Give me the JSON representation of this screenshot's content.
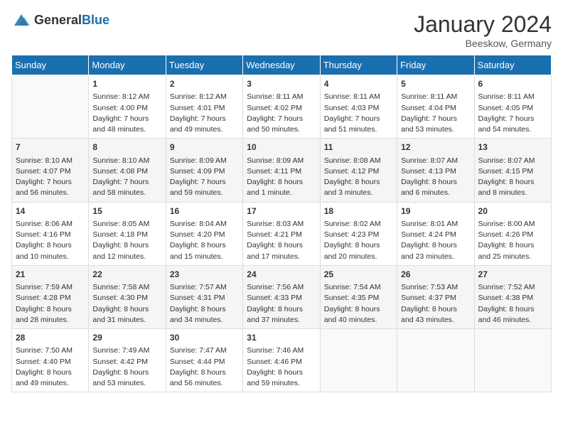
{
  "header": {
    "logo_general": "General",
    "logo_blue": "Blue",
    "month_year": "January 2024",
    "location": "Beeskow, Germany"
  },
  "days_of_week": [
    "Sunday",
    "Monday",
    "Tuesday",
    "Wednesday",
    "Thursday",
    "Friday",
    "Saturday"
  ],
  "weeks": [
    [
      {
        "day": "",
        "info": ""
      },
      {
        "day": "1",
        "info": "Sunrise: 8:12 AM\nSunset: 4:00 PM\nDaylight: 7 hours\nand 48 minutes."
      },
      {
        "day": "2",
        "info": "Sunrise: 8:12 AM\nSunset: 4:01 PM\nDaylight: 7 hours\nand 49 minutes."
      },
      {
        "day": "3",
        "info": "Sunrise: 8:11 AM\nSunset: 4:02 PM\nDaylight: 7 hours\nand 50 minutes."
      },
      {
        "day": "4",
        "info": "Sunrise: 8:11 AM\nSunset: 4:03 PM\nDaylight: 7 hours\nand 51 minutes."
      },
      {
        "day": "5",
        "info": "Sunrise: 8:11 AM\nSunset: 4:04 PM\nDaylight: 7 hours\nand 53 minutes."
      },
      {
        "day": "6",
        "info": "Sunrise: 8:11 AM\nSunset: 4:05 PM\nDaylight: 7 hours\nand 54 minutes."
      }
    ],
    [
      {
        "day": "7",
        "info": "Sunrise: 8:10 AM\nSunset: 4:07 PM\nDaylight: 7 hours\nand 56 minutes."
      },
      {
        "day": "8",
        "info": "Sunrise: 8:10 AM\nSunset: 4:08 PM\nDaylight: 7 hours\nand 58 minutes."
      },
      {
        "day": "9",
        "info": "Sunrise: 8:09 AM\nSunset: 4:09 PM\nDaylight: 7 hours\nand 59 minutes."
      },
      {
        "day": "10",
        "info": "Sunrise: 8:09 AM\nSunset: 4:11 PM\nDaylight: 8 hours\nand 1 minute."
      },
      {
        "day": "11",
        "info": "Sunrise: 8:08 AM\nSunset: 4:12 PM\nDaylight: 8 hours\nand 3 minutes."
      },
      {
        "day": "12",
        "info": "Sunrise: 8:07 AM\nSunset: 4:13 PM\nDaylight: 8 hours\nand 6 minutes."
      },
      {
        "day": "13",
        "info": "Sunrise: 8:07 AM\nSunset: 4:15 PM\nDaylight: 8 hours\nand 8 minutes."
      }
    ],
    [
      {
        "day": "14",
        "info": "Sunrise: 8:06 AM\nSunset: 4:16 PM\nDaylight: 8 hours\nand 10 minutes."
      },
      {
        "day": "15",
        "info": "Sunrise: 8:05 AM\nSunset: 4:18 PM\nDaylight: 8 hours\nand 12 minutes."
      },
      {
        "day": "16",
        "info": "Sunrise: 8:04 AM\nSunset: 4:20 PM\nDaylight: 8 hours\nand 15 minutes."
      },
      {
        "day": "17",
        "info": "Sunrise: 8:03 AM\nSunset: 4:21 PM\nDaylight: 8 hours\nand 17 minutes."
      },
      {
        "day": "18",
        "info": "Sunrise: 8:02 AM\nSunset: 4:23 PM\nDaylight: 8 hours\nand 20 minutes."
      },
      {
        "day": "19",
        "info": "Sunrise: 8:01 AM\nSunset: 4:24 PM\nDaylight: 8 hours\nand 23 minutes."
      },
      {
        "day": "20",
        "info": "Sunrise: 8:00 AM\nSunset: 4:26 PM\nDaylight: 8 hours\nand 25 minutes."
      }
    ],
    [
      {
        "day": "21",
        "info": "Sunrise: 7:59 AM\nSunset: 4:28 PM\nDaylight: 8 hours\nand 28 minutes."
      },
      {
        "day": "22",
        "info": "Sunrise: 7:58 AM\nSunset: 4:30 PM\nDaylight: 8 hours\nand 31 minutes."
      },
      {
        "day": "23",
        "info": "Sunrise: 7:57 AM\nSunset: 4:31 PM\nDaylight: 8 hours\nand 34 minutes."
      },
      {
        "day": "24",
        "info": "Sunrise: 7:56 AM\nSunset: 4:33 PM\nDaylight: 8 hours\nand 37 minutes."
      },
      {
        "day": "25",
        "info": "Sunrise: 7:54 AM\nSunset: 4:35 PM\nDaylight: 8 hours\nand 40 minutes."
      },
      {
        "day": "26",
        "info": "Sunrise: 7:53 AM\nSunset: 4:37 PM\nDaylight: 8 hours\nand 43 minutes."
      },
      {
        "day": "27",
        "info": "Sunrise: 7:52 AM\nSunset: 4:38 PM\nDaylight: 8 hours\nand 46 minutes."
      }
    ],
    [
      {
        "day": "28",
        "info": "Sunrise: 7:50 AM\nSunset: 4:40 PM\nDaylight: 8 hours\nand 49 minutes."
      },
      {
        "day": "29",
        "info": "Sunrise: 7:49 AM\nSunset: 4:42 PM\nDaylight: 8 hours\nand 53 minutes."
      },
      {
        "day": "30",
        "info": "Sunrise: 7:47 AM\nSunset: 4:44 PM\nDaylight: 8 hours\nand 56 minutes."
      },
      {
        "day": "31",
        "info": "Sunrise: 7:46 AM\nSunset: 4:46 PM\nDaylight: 8 hours\nand 59 minutes."
      },
      {
        "day": "",
        "info": ""
      },
      {
        "day": "",
        "info": ""
      },
      {
        "day": "",
        "info": ""
      }
    ]
  ]
}
